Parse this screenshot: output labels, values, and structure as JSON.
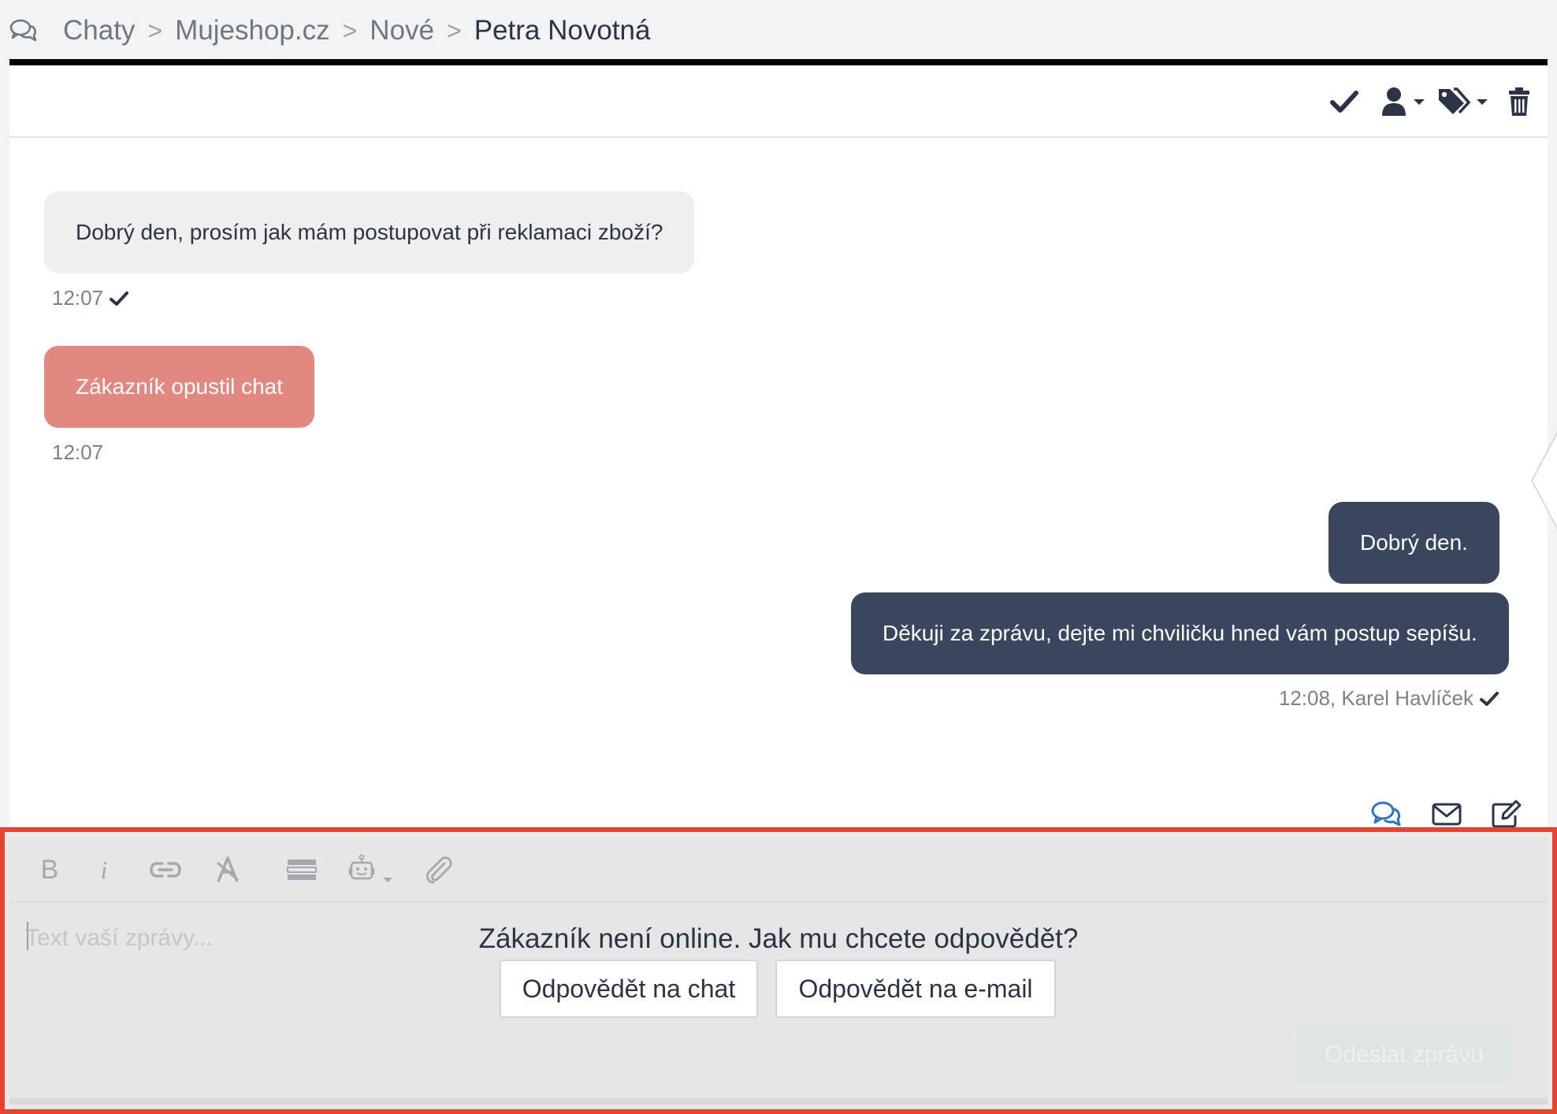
{
  "breadcrumb": {
    "items": [
      "Chaty",
      "Mujeshop.cz",
      "Nové"
    ],
    "current": "Petra Novotná",
    "separator": ">"
  },
  "toolbar": {
    "icons": [
      "check-icon",
      "user-assign-icon",
      "tags-icon",
      "trash-icon"
    ]
  },
  "messages": [
    {
      "text": "Dobrý den, prosím jak mám postupovat při reklamaci zboží?",
      "time": "12:07",
      "side": "in"
    },
    {
      "text": "Zákazník opustil chat",
      "time": "12:07",
      "side": "system"
    },
    {
      "text": "Dobrý den.",
      "side": "out"
    },
    {
      "text": "Děkuji za zprávu, dejte mi chviličku hned vám postup sepíšu.",
      "time": "12:08, Karel Havlíček",
      "side": "out"
    }
  ],
  "channels": [
    "chat-channel-icon",
    "email-channel-icon",
    "note-channel-icon"
  ],
  "composer": {
    "placeholder": "Text vaší zprávy...",
    "offline_question": "Zákazník není online. Jak mu chcete odpovědět?",
    "reply_chat_label": "Odpovědět na chat",
    "reply_email_label": "Odpovědět na e-mail",
    "send_label": "Odeslat zprávu",
    "format_bold": "B",
    "format_italic": "i"
  },
  "colors": {
    "accent_dark": "#3a465e",
    "left_chat": "#e38781",
    "highlight_border": "#e8432f",
    "link_blue": "#2f74c0"
  }
}
